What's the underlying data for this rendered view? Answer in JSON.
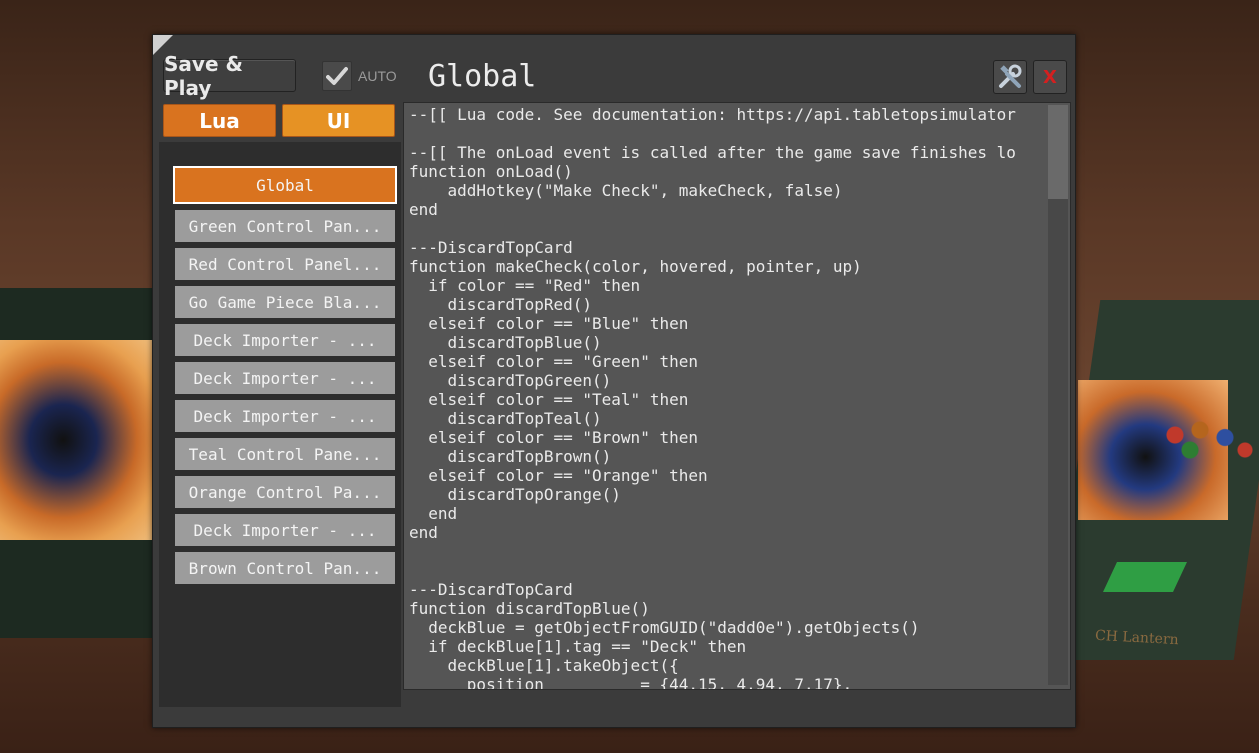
{
  "toolbar": {
    "save_label": "Save & Play",
    "auto_label": "AUTO",
    "auto_checked": true,
    "close_label": "X"
  },
  "editor_title": "Global",
  "tabs": [
    {
      "label": "Lua"
    },
    {
      "label": "UI"
    }
  ],
  "scripts": [
    {
      "label": "Global",
      "active": true
    },
    {
      "label": "Green Control Pan..."
    },
    {
      "label": "Red Control Panel..."
    },
    {
      "label": "Go Game Piece Bla..."
    },
    {
      "label": "Deck Importer - ..."
    },
    {
      "label": "Deck Importer - ..."
    },
    {
      "label": "Deck Importer - ..."
    },
    {
      "label": "Teal Control Pane..."
    },
    {
      "label": "Orange Control Pa..."
    },
    {
      "label": "Deck Importer - ..."
    },
    {
      "label": "Brown Control Pan..."
    }
  ],
  "code": "--[[ Lua code. See documentation: https://api.tabletopsimulator\n\n--[[ The onLoad event is called after the game save finishes lo\nfunction onLoad()\n    addHotkey(\"Make Check\", makeCheck, false)\nend\n\n---DiscardTopCard\nfunction makeCheck(color, hovered, pointer, up)\n  if color == \"Red\" then\n    discardTopRed()\n  elseif color == \"Blue\" then\n    discardTopBlue()\n  elseif color == \"Green\" then\n    discardTopGreen()\n  elseif color == \"Teal\" then\n    discardTopTeal()\n  elseif color == \"Brown\" then\n    discardTopBrown()\n  elseif color == \"Orange\" then\n    discardTopOrange()\n  end\nend\n\n\n---DiscardTopCard\nfunction discardTopBlue()\n  deckBlue = getObjectFromGUID(\"dadd0e\").getObjects()\n  if deckBlue[1].tag == \"Deck\" then\n    deckBlue[1].takeObject({\n      position          = {44.15, 4.94, 7.17},",
  "background": {
    "table_label": "CH Lantern"
  },
  "colors": {
    "accent": "#d9731f",
    "close": "#d32020",
    "editor_bg": "#555555",
    "window_bg": "#3b3b3b"
  },
  "icons": {
    "auto_check": "checkmark-icon",
    "tools": "tools-icon",
    "close": "close-icon"
  }
}
